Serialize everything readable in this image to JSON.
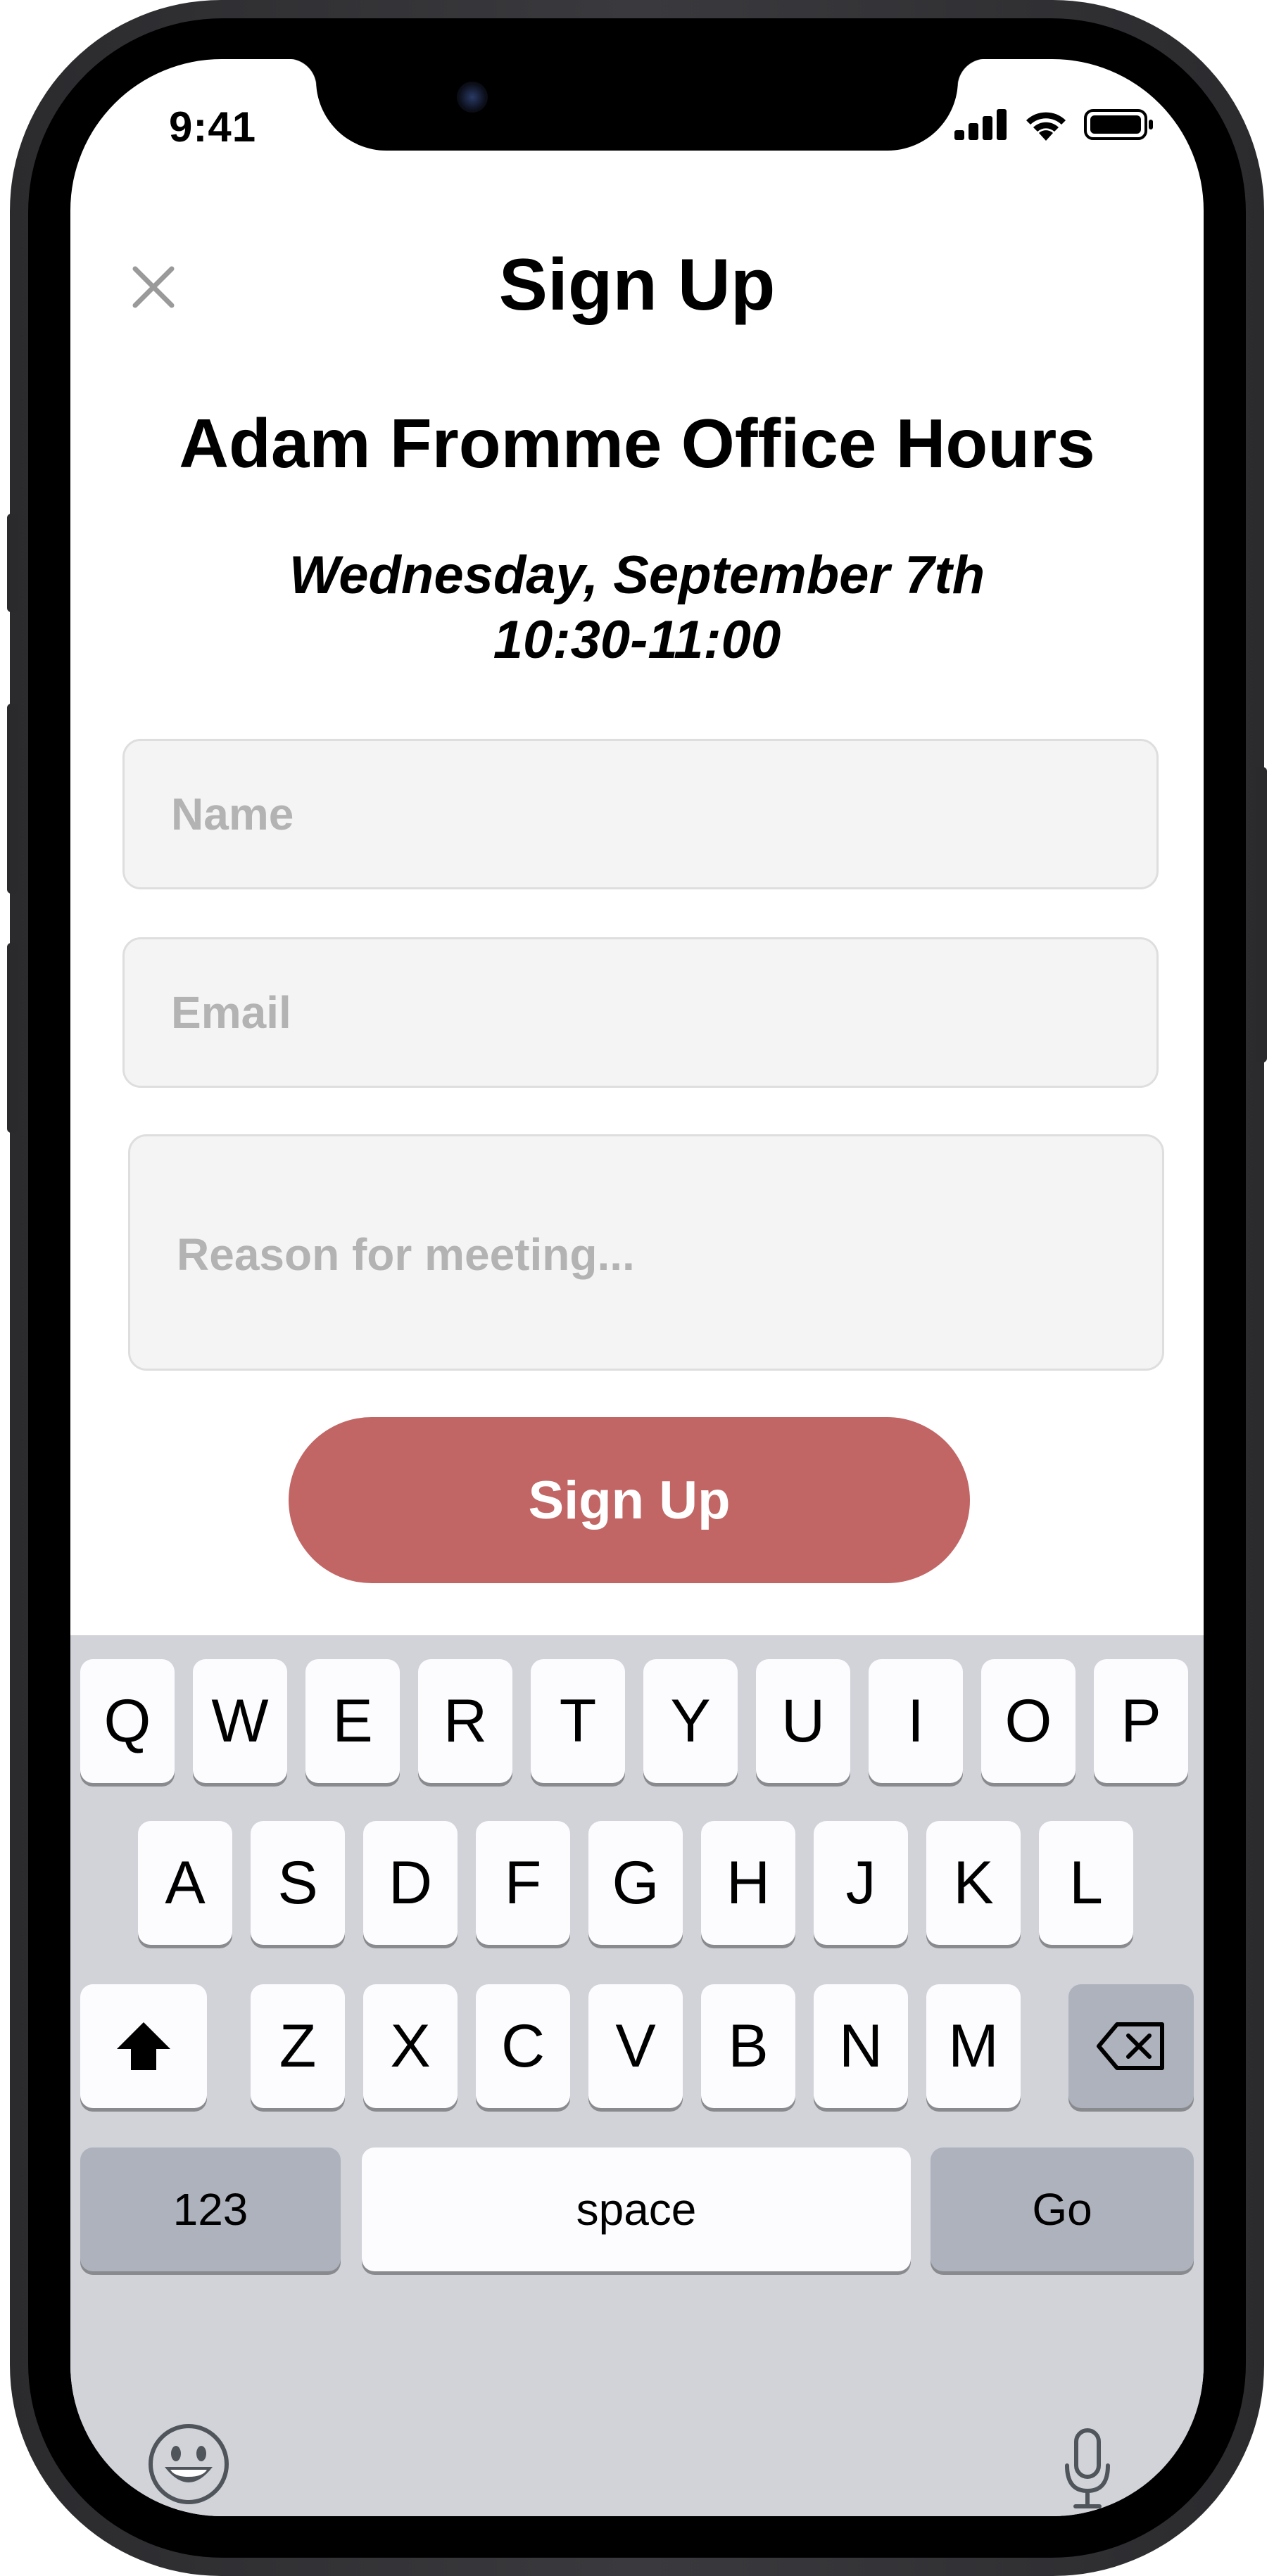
{
  "status_bar": {
    "time": "9:41"
  },
  "nav": {
    "title": "Sign Up"
  },
  "event": {
    "title": "Adam Fromme Office Hours",
    "date": "Wednesday, September 7th",
    "time": "10:30-11:00"
  },
  "form": {
    "name_placeholder": "Name",
    "email_placeholder": "Email",
    "reason_placeholder": "Reason for meeting...",
    "submit_label": "Sign Up"
  },
  "keyboard": {
    "row1": [
      "Q",
      "W",
      "E",
      "R",
      "T",
      "Y",
      "U",
      "I",
      "O",
      "P"
    ],
    "row2": [
      "A",
      "S",
      "D",
      "F",
      "G",
      "H",
      "J",
      "K",
      "L"
    ],
    "row3": [
      "Z",
      "X",
      "C",
      "V",
      "B",
      "N",
      "M"
    ],
    "numbers_label": "123",
    "space_label": "space",
    "go_label": "Go"
  },
  "colors": {
    "accent": "#c26565",
    "field_bg": "#f4f4f4",
    "keyboard_bg": "#d1d3d9"
  }
}
